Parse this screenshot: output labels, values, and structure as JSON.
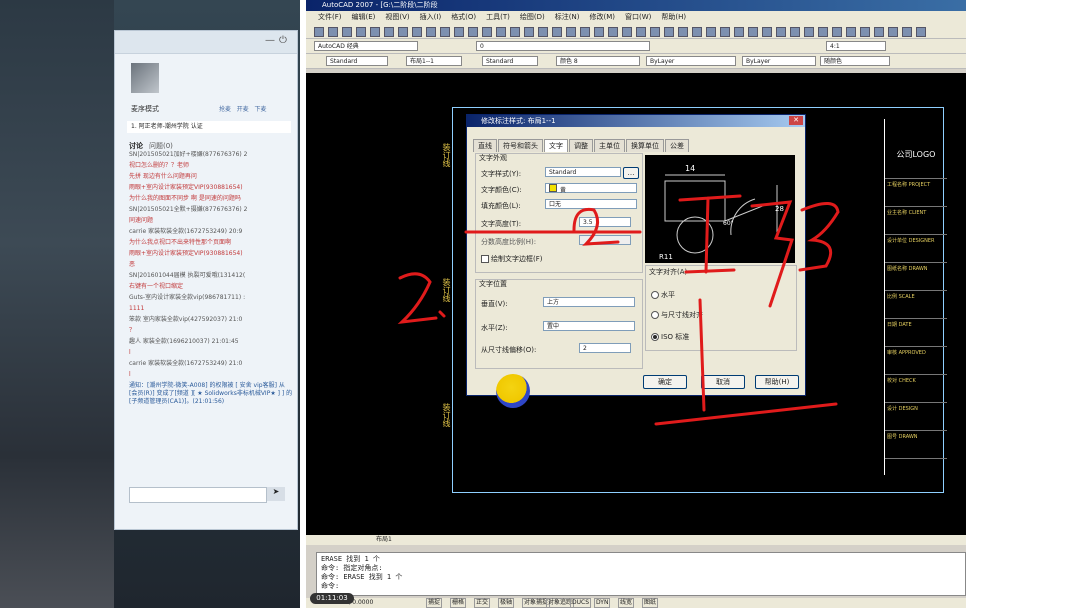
{
  "left_panel": {
    "mode_label": "麦序模式",
    "tabs_mini": [
      "抢麦",
      "开麦",
      "下麦"
    ],
    "room_label": "1. 阿正老师-潮州学院 认证",
    "discussion_tab": "讨论",
    "question_tab": "问题(0)",
    "messages": [
      {
        "text": "SN|201505021加好+楼嫌(877676376) 2",
        "color": "gray"
      },
      {
        "text": "视口怎么删的？？老师",
        "color": "red"
      },
      {
        "text": "先拼 现边有什么问题再问",
        "color": "red"
      },
      {
        "text": "雨眼+室内设计家装预定VIP(930881654)",
        "color": "red"
      },
      {
        "text": "为什么我的图面不同步 啊  是同速的问题吗",
        "color": "red"
      },
      {
        "text": "SN|201505021全默+摄嫌(877676376) 2",
        "color": "gray"
      },
      {
        "text": "同速问题",
        "color": "red"
      },
      {
        "text": "carrie  家装软装全款(1672753249) 20:9",
        "color": "gray"
      },
      {
        "text": "为什么我点视口不出来特性那个页面啊",
        "color": "red"
      },
      {
        "text": "雨眼+室内设计家装预定VIP(930881654)",
        "color": "red"
      },
      {
        "text": "恶",
        "color": "red"
      },
      {
        "text": "SN|201601044届模 执裂可爱哦(131412(",
        "color": "gray"
      },
      {
        "text": "右键有一个视口缩定",
        "color": "red"
      },
      {
        "text": "Guts-室内设计家装全款vip(986781711) :",
        "color": "gray"
      },
      {
        "text": "1111",
        "color": "red"
      },
      {
        "text": "笨款 室内家装全款vip(427592037) 21:0",
        "color": "gray"
      },
      {
        "text": "？",
        "color": "red"
      },
      {
        "text": "趣人 家装全款(1696210037) 21:01:45",
        "color": "gray"
      },
      {
        "text": "l",
        "color": "red"
      },
      {
        "text": "carrie  家装软装全款(1672753249) 21:0",
        "color": "gray"
      },
      {
        "text": "l",
        "color": "red"
      },
      {
        "text": "通知：[潮州学院-微笑-A008] 的权限被 [ 安舍 vip客服] 从 [会员(R)] 变成了[频道 ][ ★ Solidworks非标机械VIP★ ] ] 的 [子频道管理员(CA1)]。(21:01:56)",
        "color": "blue"
      }
    ]
  },
  "acad": {
    "title": "AutoCAD 2007 - [G:\\二阶段\\二阶段",
    "menu": [
      "文件(F)",
      "编辑(E)",
      "视图(V)",
      "插入(I)",
      "格式(O)",
      "工具(T)",
      "绘图(D)",
      "标注(N)",
      "修改(M)",
      "窗口(W)",
      "帮助(H)"
    ],
    "workspace": "AutoCAD 经典",
    "layer_value": "0",
    "style_combo_1": "Standard",
    "layout_combo": "布局1--1",
    "style_combo_2": "Standard",
    "color_combo": "颜色 8",
    "linetype_1": "ByLayer",
    "linetype_2": "ByLayer",
    "plot_combo": "随颜色",
    "scale_combo": "4:1",
    "sheet_labels": {
      "binding": "装订线",
      "logo": "公司LOGO"
    },
    "titleblock_rows": [
      "工程名称 PROJECT",
      "业主名称 CLIENT",
      "设计单位 DESIGNER",
      "图纸名称 DRAWN",
      "比例 SCALE",
      "日期 DATE",
      "审核 APPROVED",
      "校对 CHECK",
      "设计 DESIGN",
      "图号 DRAWN"
    ],
    "command_lines": [
      "ERASE 找到 1 个",
      "命令: 指定对角点:",
      "命令:  ERASE 找到 1 个",
      "命令:"
    ],
    "coords": "1550.6874, 0.0000",
    "status_items": [
      "捕捉",
      "栅格",
      "正交",
      "极轴",
      "对象捕捉",
      "对象追踪",
      "DUCS",
      "DYN",
      "线宽",
      "图纸"
    ],
    "layout_tab": "布局1",
    "timer": "01:11:03"
  },
  "dialog": {
    "title": "修改标注样式: 布局1--1",
    "tabs": [
      "直线",
      "符号和箭头",
      "文字",
      "调整",
      "主单位",
      "换算单位",
      "公差"
    ],
    "active_tab": "文字",
    "appearance": {
      "group_title": "文字外观",
      "style_label": "文字样式(Y):",
      "style_value": "Standard",
      "color_label": "文字颜色(C):",
      "color_value": "黄",
      "fill_label": "填充颜色(L):",
      "fill_value": "口无",
      "height_label": "文字高度(T):",
      "height_value": "3.5",
      "ratio_label": "分数高度比例(H):",
      "frame_label": "绘制文字边框(F)"
    },
    "position": {
      "group_title": "文字位置",
      "vertical_label": "垂直(V):",
      "vertical_value": "上方",
      "horizontal_label": "水平(Z):",
      "horizontal_value": "置中",
      "offset_label": "从尺寸线偏移(O):",
      "offset_value": "2"
    },
    "alignment": {
      "group_title": "文字对齐(A)",
      "options": [
        "水平",
        "与尺寸线对齐",
        "ISO 标准"
      ],
      "selected": "ISO 标准"
    },
    "preview_labels": {
      "dim_top": "14",
      "dim_right": "28",
      "radius": "R11",
      "angle": "60°"
    },
    "buttons": {
      "ok": "确定",
      "cancel": "取消",
      "help": "帮助(H)"
    }
  },
  "annotations": {
    "handwriting": [
      "2.",
      "2",
      "I",
      "3"
    ],
    "ink_color": "#e01b1b"
  }
}
